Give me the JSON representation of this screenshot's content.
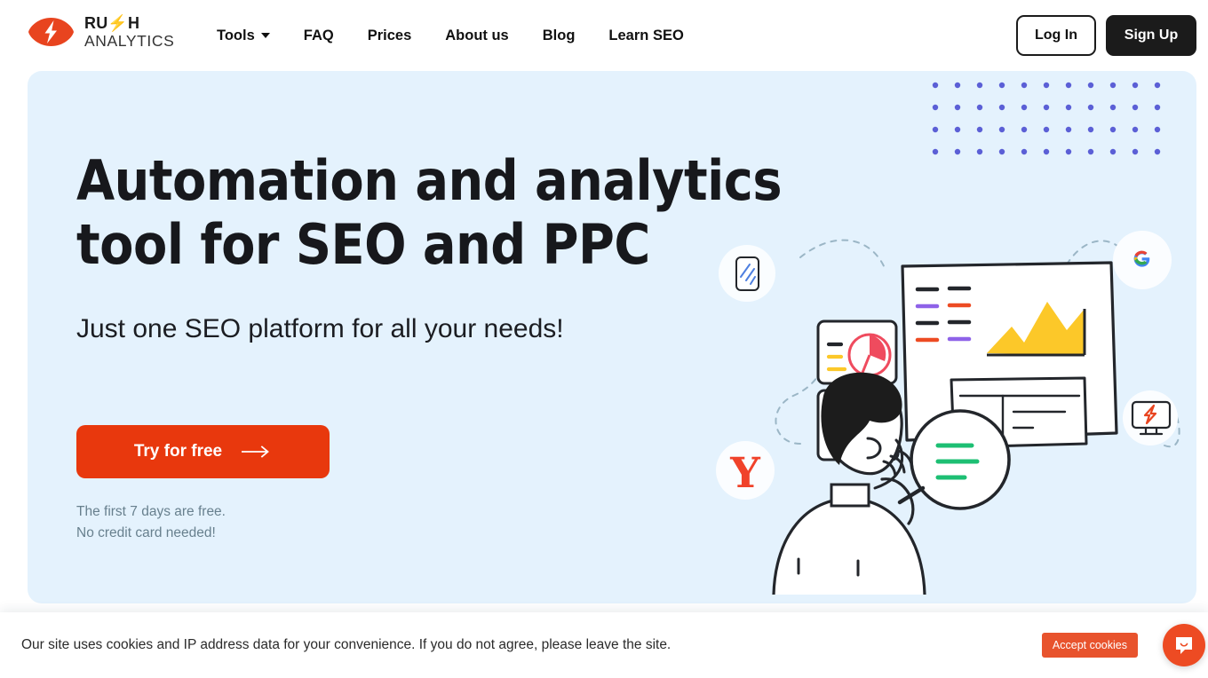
{
  "header": {
    "logo": {
      "name": "rush-analytics-logo",
      "line1": "RU⚡H",
      "line2": "ANALYTICS",
      "mark_color": "#e8441f"
    },
    "nav": [
      {
        "label": "Tools",
        "has_dropdown": true
      },
      {
        "label": "FAQ",
        "has_dropdown": false
      },
      {
        "label": "Prices",
        "has_dropdown": false
      },
      {
        "label": "About us",
        "has_dropdown": false
      },
      {
        "label": "Blog",
        "has_dropdown": false
      },
      {
        "label": "Learn SEO",
        "has_dropdown": false
      }
    ],
    "login_label": "Log In",
    "signup_label": "Sign Up"
  },
  "hero": {
    "background": "#e4f2fd",
    "heading": "Automation and analytics tool for SEO and PPC",
    "subheading": "Just one SEO platform for all your needs!",
    "cta_label": "Try for free",
    "cta_color": "#e8380d",
    "note_line1": "The first 7 days are free.",
    "note_line2": "No credit card needed!",
    "dots": {
      "columns": 11,
      "rows": 4,
      "color": "#5b5fd6",
      "spacing": 25
    },
    "illustration": {
      "name": "seo-analytics-illustration",
      "badges": [
        {
          "name": "mobile-phone-icon",
          "label": ""
        },
        {
          "name": "google-g-icon",
          "label": "G"
        },
        {
          "name": "yandex-y-icon",
          "label": "Y"
        },
        {
          "name": "rush-monitor-icon",
          "label": ""
        }
      ]
    }
  },
  "cookiebar": {
    "text": "Our site uses cookies and IP address data for your convenience. If you do not agree, please leave the site.",
    "accept_label": "Accept cookies",
    "accept_color": "#e8532d",
    "chat_color": "#ed4b23"
  }
}
